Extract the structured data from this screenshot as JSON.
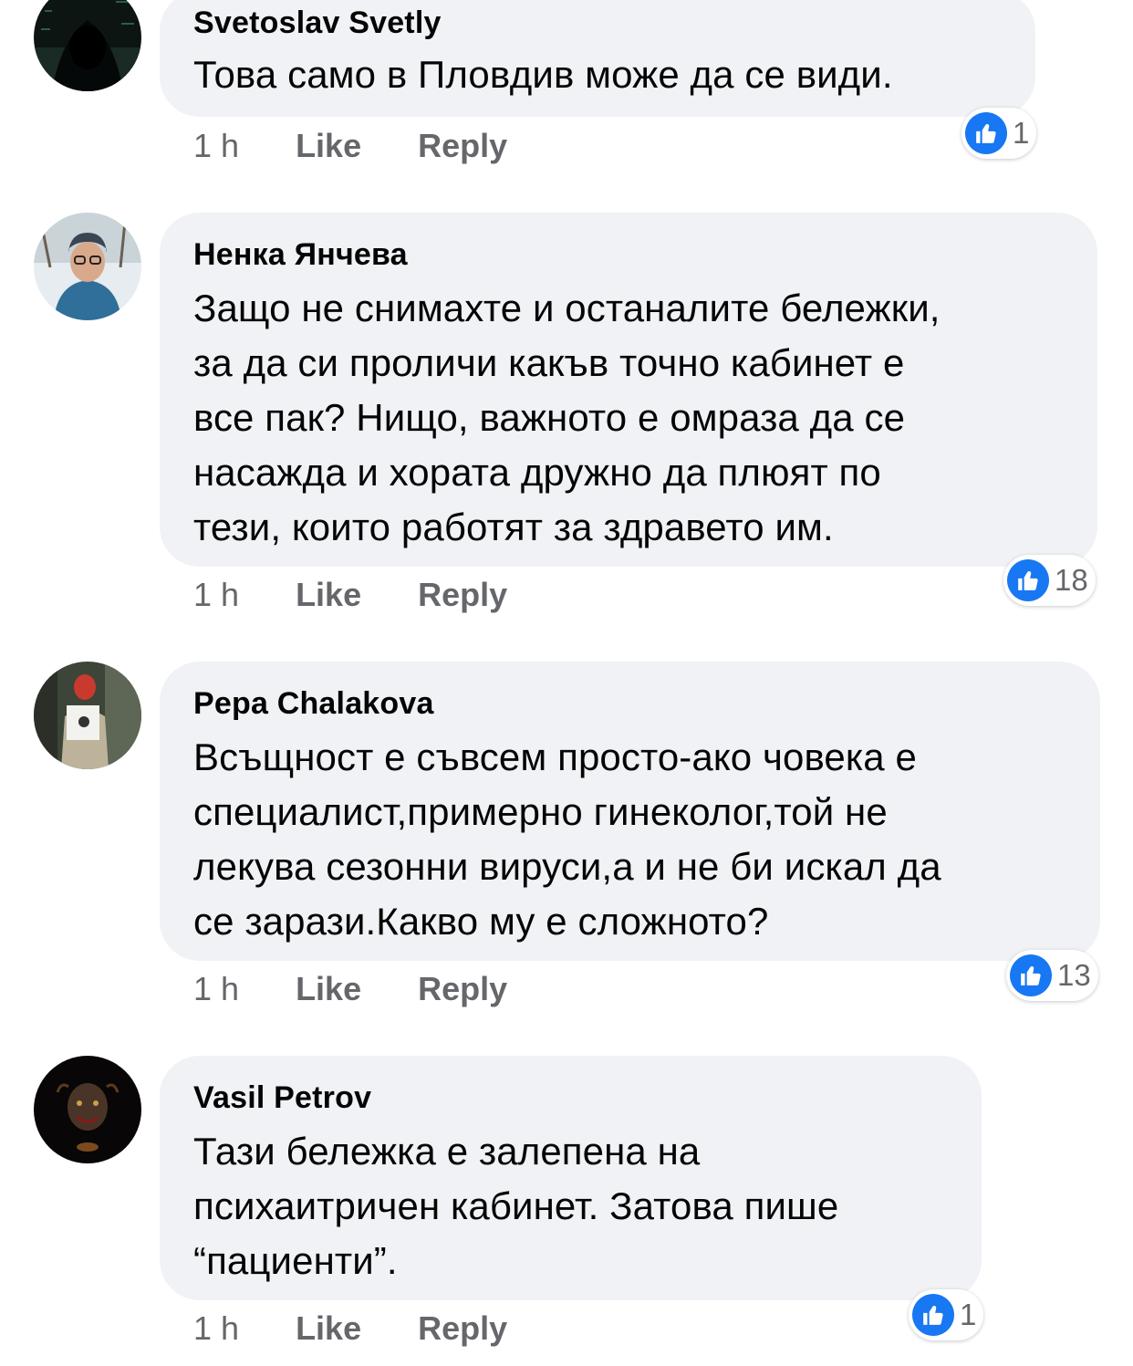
{
  "colors": {
    "bubble_bg": "#f0f2f5",
    "text": "#050505",
    "meta_text": "#65676b",
    "like_blue": "#1877f2"
  },
  "comments": [
    {
      "author": "Svetoslav Svetly",
      "lines": [
        "Това само в Пловдив може да се види."
      ],
      "time": "1 h",
      "like_label": "Like",
      "reply_label": "Reply",
      "reaction_icon": "thumbs-up-icon",
      "reaction_count": "1"
    },
    {
      "author": "Ненка Янчева",
      "lines": [
        "Защо не снимахте и останалите бележки,",
        "за да си проличи какъв точно кабинет е",
        "все пак? Нищо, важното е омраза да се",
        "насажда и хората дружно да плюят по",
        "тези, които работят за здравето им."
      ],
      "time": "1 h",
      "like_label": "Like",
      "reply_label": "Reply",
      "reaction_icon": "thumbs-up-icon",
      "reaction_count": "18"
    },
    {
      "author": "Pepa Chalakova",
      "lines": [
        "Всъщност е съвсем просто-ако човека е",
        "специалист,примерно гинеколог,той не",
        "лекува сезонни вируси,а и не би искал да",
        "се зарази.Какво му е сложното?"
      ],
      "time": "1 h",
      "like_label": "Like",
      "reply_label": "Reply",
      "reaction_icon": "thumbs-up-icon",
      "reaction_count": "13"
    },
    {
      "author": "Vasil Petrov",
      "lines": [
        "Тази бележка е залепена на",
        "психаитричен кабинет. Затова пише",
        "“пациенти”."
      ],
      "time": "1 h",
      "like_label": "Like",
      "reply_label": "Reply",
      "reaction_icon": "thumbs-up-icon",
      "reaction_count": "1"
    }
  ]
}
